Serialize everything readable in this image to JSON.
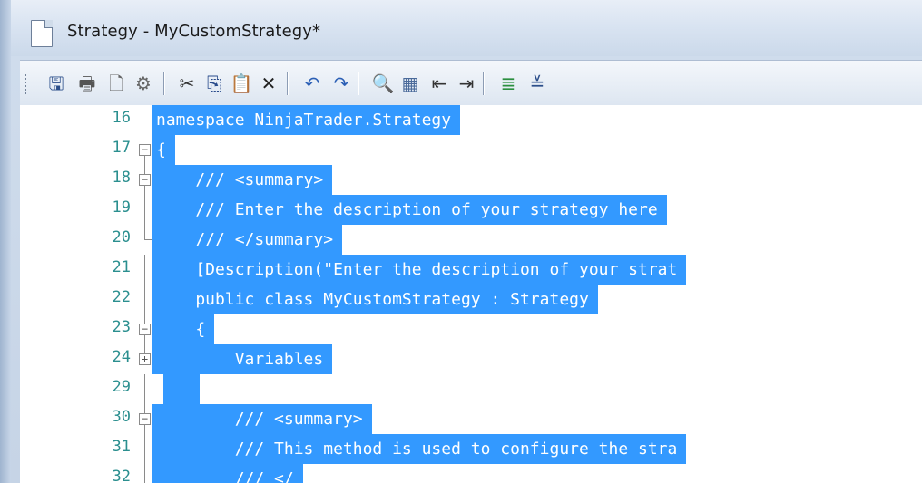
{
  "window": {
    "title": "Strategy - MyCustomStrategy*"
  },
  "toolbar": {
    "buttons": [
      {
        "name": "save-icon",
        "glyph": "🖫",
        "color": "#2b4e8a"
      },
      {
        "name": "print-icon",
        "glyph": "🖶",
        "color": "#555"
      },
      {
        "name": "print-preview-icon",
        "glyph": "🗋",
        "color": "#666"
      },
      {
        "name": "page-setup-icon",
        "glyph": "⚙",
        "color": "#666"
      },
      {
        "name": "cut-icon",
        "glyph": "✂",
        "color": "#333"
      },
      {
        "name": "copy-icon",
        "glyph": "⎘",
        "color": "#2a4c8c"
      },
      {
        "name": "paste-icon",
        "glyph": "📋",
        "color": "#b07d2b"
      },
      {
        "name": "delete-icon",
        "glyph": "✕",
        "color": "#222"
      },
      {
        "name": "undo-icon",
        "glyph": "↶",
        "color": "#2b5fb5"
      },
      {
        "name": "redo-icon",
        "glyph": "↷",
        "color": "#2b5fb5"
      },
      {
        "name": "find-icon",
        "glyph": "🔍",
        "color": "#333"
      },
      {
        "name": "replace-icon",
        "glyph": "▦",
        "color": "#4a6a9a"
      },
      {
        "name": "outdent-icon",
        "glyph": "⇤",
        "color": "#333"
      },
      {
        "name": "indent-icon",
        "glyph": "⇥",
        "color": "#333"
      },
      {
        "name": "comment-icon",
        "glyph": "≣",
        "color": "#2b8f3f"
      },
      {
        "name": "uncomment-icon",
        "glyph": "≚",
        "color": "#2b4e8a"
      }
    ]
  },
  "editor": {
    "lines": [
      {
        "num": "16",
        "text": "namespace NinjaTrader.Strategy",
        "fold": "none"
      },
      {
        "num": "17",
        "text": "{",
        "fold": "open"
      },
      {
        "num": "18",
        "text": "    /// <summary>",
        "fold": "open"
      },
      {
        "num": "19",
        "text": "    /// Enter the description of your strategy here",
        "fold": "line"
      },
      {
        "num": "20",
        "text": "    /// </summary>",
        "fold": "end"
      },
      {
        "num": "21",
        "text": "    [Description(\"Enter the description of your strat",
        "fold": "line"
      },
      {
        "num": "22",
        "text": "    public class MyCustomStrategy : Strategy",
        "fold": "line"
      },
      {
        "num": "23",
        "text": "    {",
        "fold": "open"
      },
      {
        "num": "24",
        "text": "        Variables",
        "fold": "collapsed"
      },
      {
        "num": "29",
        "text": "",
        "fold": "line"
      },
      {
        "num": "30",
        "text": "        /// <summary>",
        "fold": "open"
      },
      {
        "num": "31",
        "text": "        /// This method is used to configure the stra",
        "fold": "line"
      },
      {
        "num": "32",
        "text": "        /// </",
        "fold": "line"
      }
    ]
  },
  "colors": {
    "selection": "#3399ff",
    "line_number": "#2b8f8f"
  }
}
